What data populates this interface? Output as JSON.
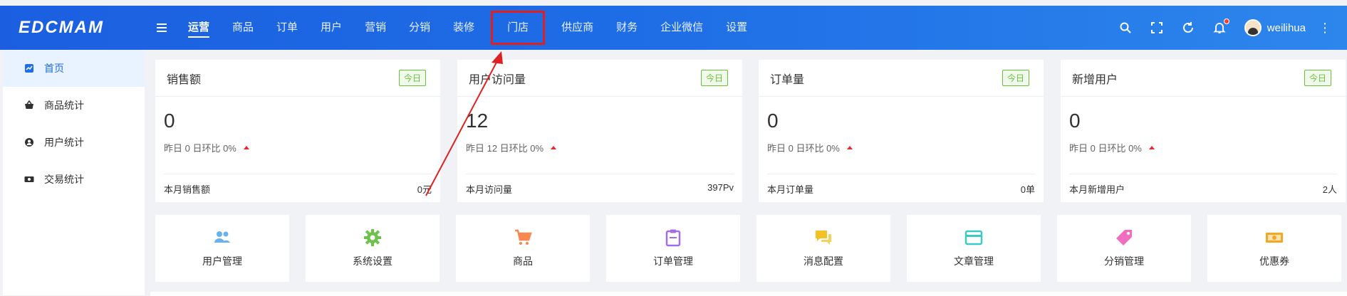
{
  "header": {
    "logo_text": "EDCMAM",
    "nav": [
      {
        "label": "运营",
        "active": true
      },
      {
        "label": "商品"
      },
      {
        "label": "订单"
      },
      {
        "label": "用户"
      },
      {
        "label": "营销"
      },
      {
        "label": "分销"
      },
      {
        "label": "装修"
      },
      {
        "label": "门店",
        "highlight": true
      },
      {
        "label": "供应商"
      },
      {
        "label": "财务"
      },
      {
        "label": "企业微信"
      },
      {
        "label": "设置"
      }
    ],
    "icons": [
      "search-icon",
      "fullscreen-icon",
      "refresh-icon",
      "bell-icon"
    ],
    "username": "weilihua",
    "more": "⋮"
  },
  "sidebar": {
    "items": [
      {
        "label": "首页",
        "icon": "dashboard-icon",
        "active": true
      },
      {
        "label": "商品统计",
        "icon": "basket-icon"
      },
      {
        "label": "用户统计",
        "icon": "user-circle-icon"
      },
      {
        "label": "交易统计",
        "icon": "money-icon"
      }
    ]
  },
  "stats": [
    {
      "title": "销售额",
      "tag": "今日",
      "value": "0",
      "compare": "昨日 0  日环比 0%",
      "foot_label": "本月销售额",
      "foot_value": "0元"
    },
    {
      "title": "用户访问量",
      "tag": "今日",
      "value": "12",
      "compare": "昨日 12  日环比 0%",
      "foot_label": "本月访问量",
      "foot_value": "397Pv"
    },
    {
      "title": "订单量",
      "tag": "今日",
      "value": "0",
      "compare": "昨日 0  日环比 0%",
      "foot_label": "本月订单量",
      "foot_value": "0单"
    },
    {
      "title": "新增用户",
      "tag": "今日",
      "value": "0",
      "compare": "昨日 0  日环比 0%",
      "foot_label": "本月新增用户",
      "foot_value": "2人"
    }
  ],
  "quick_links": [
    {
      "label": "用户管理",
      "icon": "users-icon",
      "color": "#69b1f0"
    },
    {
      "label": "系统设置",
      "icon": "gear-icon",
      "color": "#6cc24a"
    },
    {
      "label": "商品",
      "icon": "cart-icon",
      "color": "#f7884f"
    },
    {
      "label": "订单管理",
      "icon": "clipboard-icon",
      "color": "#a66ce6"
    },
    {
      "label": "消息配置",
      "icon": "chat-icon",
      "color": "#f5c022"
    },
    {
      "label": "文章管理",
      "icon": "card-icon",
      "color": "#3ec9c4"
    },
    {
      "label": "分销管理",
      "icon": "tag-icon",
      "color": "#f06ec0"
    },
    {
      "label": "优惠券",
      "icon": "coupon-icon",
      "color": "#f5a623"
    }
  ],
  "colors": {
    "accent": "#1f6ee6",
    "tag_green": "#67c23a",
    "annotation_red": "#e02020"
  }
}
